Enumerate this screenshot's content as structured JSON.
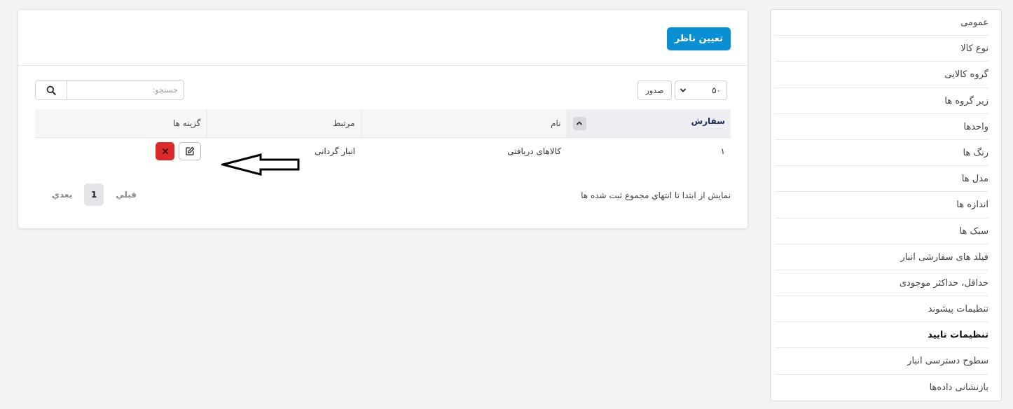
{
  "sidebar": {
    "items": [
      {
        "label": "عمومی"
      },
      {
        "label": "نوع کالا"
      },
      {
        "label": "گروه کالایی"
      },
      {
        "label": "زیر گروه ها"
      },
      {
        "label": "واحدها"
      },
      {
        "label": "رنگ ها"
      },
      {
        "label": "مدل ها"
      },
      {
        "label": "اندازه ها"
      },
      {
        "label": "سبک ها"
      },
      {
        "label": "فیلد های سفارشی انبار"
      },
      {
        "label": "حداقل، حداکثر موجودی"
      },
      {
        "label": "تنظیمات پیشوند"
      },
      {
        "label": "تنظیمات تایید",
        "active": true
      },
      {
        "label": "سطوح دسترسی انبار"
      },
      {
        "label": "بازنشانی داده‌ها"
      }
    ]
  },
  "header": {
    "assign_button": "تعیین ناظر"
  },
  "toolbar": {
    "page_length": "۵۰",
    "export_label": "صدور",
    "search_placeholder": "جستجو:"
  },
  "table": {
    "columns": [
      "سفارش",
      "نام",
      "مرتبط",
      "گزینه ها"
    ],
    "rows": [
      {
        "order": "۱",
        "name": "کالاهای دریافتی",
        "related": "انبار گردانی"
      }
    ]
  },
  "footer": {
    "info": "نمایش از ابتدا تا انتهاي مجموع ثبت شده ها",
    "prev": "قبلي",
    "current_page": "1",
    "next": "بعدي"
  },
  "colors": {
    "primary": "#0a8fd3",
    "danger": "#dc2a2a"
  }
}
